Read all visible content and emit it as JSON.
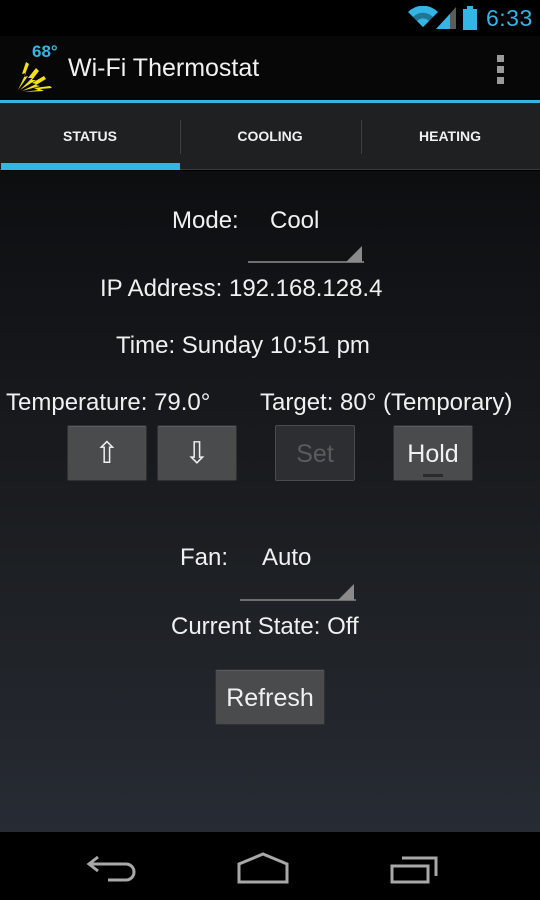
{
  "status_bar": {
    "time": "6:33",
    "icons": [
      "wifi-icon",
      "cell-signal-icon",
      "battery-icon"
    ],
    "accent_color": "#33b5e5"
  },
  "action_bar": {
    "logo_text": "68°",
    "title": "Wi-Fi Thermostat",
    "overflow_icon": "overflow-menu-icon"
  },
  "tabs": [
    {
      "label": "STATUS",
      "selected": true
    },
    {
      "label": "COOLING",
      "selected": false
    },
    {
      "label": "HEATING",
      "selected": false
    }
  ],
  "status": {
    "mode_label": "Mode:",
    "mode_value": "Cool",
    "ip_address": "IP Address: 192.168.128.4",
    "time": "Time: Sunday 10:51 pm",
    "temperature": "Temperature: 79.0°",
    "target": "Target: 80° (Temporary)",
    "up_button": "⇧",
    "down_button": "⇩",
    "set_button": "Set",
    "hold_button": "Hold",
    "fan_label": "Fan:",
    "fan_value": "Auto",
    "current_state": "Current State: Off",
    "refresh_button": "Refresh"
  },
  "nav_bar": {
    "icons": [
      "back-icon",
      "home-icon",
      "recent-apps-icon"
    ]
  }
}
